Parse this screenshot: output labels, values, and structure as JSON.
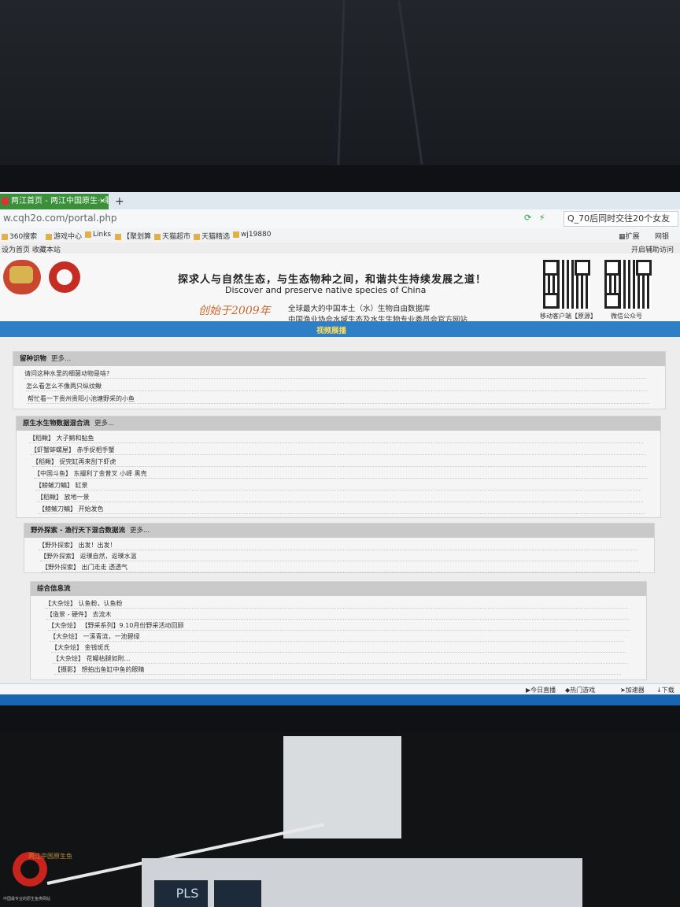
{
  "browser": {
    "tab_title": "两江首页 - 两江中国原生···聊中",
    "tab_close": "×",
    "new_tab": "+",
    "url": "w.cqh2o.com/portal.php",
    "search_text": "Q_70后同时交往20个女友",
    "bookmarks": [
      "360搜索",
      "游戏中心",
      "Links",
      "【聚划算",
      "天猫超市",
      "天猫精选",
      "wj19880"
    ],
    "extensions_label": "扩展",
    "netbank_label": "网银"
  },
  "page": {
    "top_links": "设为首页  收藏本站",
    "accessibility": "开启辅助访问",
    "slogan": "探求人与自然生态，与生态物种之间，和谐共生持续发展之道！",
    "slogan_en": "Discover and preserve native species of China",
    "since": "创始于2009年",
    "desc1": "全球最大的中国本土（水）生物自由数据库",
    "desc2": "中国渔业协会水域生态及水生生物专业委员会官方网站",
    "qr1_label": "移动客户端【原源】",
    "qr2_label": "微信公众号",
    "nav_item": "视频展播"
  },
  "sections": [
    {
      "title": "留种识物",
      "more": "更多...",
      "items": [
        "请问这种水里的细菌动物是啥?",
        "怎么看怎么不像两只纵纹鳅",
        "帮忙看一下贵州贵阳小池塘野采的小鱼"
      ]
    },
    {
      "title": "原生水生物数据混合流",
      "more": "更多...",
      "items": [
        "【稻鳅】 大子鳉和鲇鱼",
        "【虾蟹蚌螺屋】 赤手捉相手蟹",
        "【稻鳅】 捉完缸再来刮下虾虎",
        "【中国斗鱼】 东撮利了金普叉 小峄 黑壳",
        "【鳑鲏刀鳊】 缸景",
        "【稻鳅】 放地一景",
        "【鳑鲏刀鳊】 开始发色"
      ]
    },
    {
      "title": "野外探索 - 渔行天下混合数据流",
      "more": "更多...",
      "items": [
        "【野外探索】 出发！出发！",
        "【野外探索】 返璞自然，返璞水温",
        "【野外探索】 出门走走 透透气"
      ]
    },
    {
      "title": "综合信息流",
      "more": "",
      "items": [
        "【大杂烩】 认鱼粉，认鱼粉",
        "【造景 - 硬件】 去流木",
        "【大杂烩】 【野采系列】9.10月份野采活动回顾",
        "【大杂烩】 一溪青涟，一池碧绿",
        "【大杂烩】 金钱斑氏",
        "【大杂烩】 花鳗枯腿如附…",
        "【摄影】 想拍出鱼缸中鱼的眼睛"
      ]
    }
  ],
  "statusbar": {
    "items": [
      "今日直播",
      "加速器",
      "下载"
    ],
    "speedup": "热门游戏"
  },
  "watermark": {
    "text": "两江中国原生鱼",
    "sub": "中国最专业的原生鱼类网站"
  },
  "keyboard": {
    "key": "PLS"
  },
  "colors": {
    "nav_blue": "#2d7fc6",
    "tab_green": "#3c8f3a",
    "section_header": "#c9c9c9"
  }
}
